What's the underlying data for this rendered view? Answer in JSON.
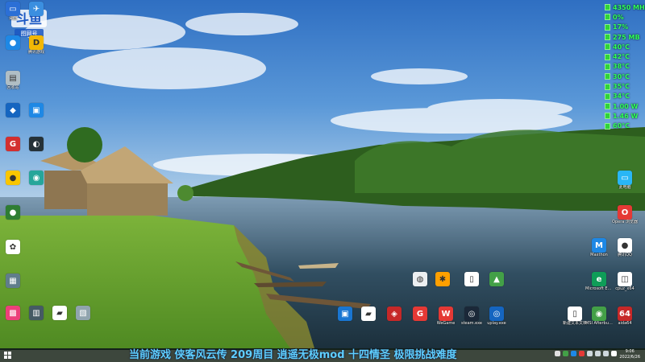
{
  "overlay": {
    "logo_top": "斗鱼",
    "logo_sub": "图网号"
  },
  "monitor": {
    "rows": [
      "4350 MHz",
      "0%",
      "17%",
      "275 MB",
      "40°C",
      "42°C",
      "38°C",
      "30°C",
      "35°C",
      "34°C",
      "1.00 W",
      "1.46 W",
      "60°C"
    ]
  },
  "desktop": {
    "icons": [
      {
        "label": "桌面",
        "color": "#2b6fd6",
        "glyph": "▭"
      },
      {
        "label": "",
        "color": "#3b8fe0",
        "glyph": "✈"
      },
      {
        "label": "",
        "color": "#1e88e5",
        "glyph": "●"
      },
      {
        "label": "腾讯游戏",
        "color": "#f2b705",
        "glyph": "D"
      },
      {
        "label": "回收站",
        "color": "#b0bec5",
        "glyph": "▤"
      },
      {
        "label": "",
        "color": "#1565c0",
        "glyph": "◆"
      },
      {
        "label": "",
        "color": "#1e88e5",
        "glyph": "▣"
      },
      {
        "label": "",
        "color": "#d32f2f",
        "glyph": "G"
      },
      {
        "label": "",
        "color": "#263238",
        "glyph": "◐"
      },
      {
        "label": "",
        "color": "#f9c600",
        "glyph": "●"
      },
      {
        "label": "",
        "color": "#26a69a",
        "glyph": "◉"
      },
      {
        "label": "",
        "color": "#2e7d32",
        "glyph": "●"
      },
      {
        "label": "",
        "color": "#ffffff",
        "glyph": "✿"
      },
      {
        "label": "",
        "color": "#607d8b",
        "glyph": "▦"
      },
      {
        "label": "",
        "color": "#ec407a",
        "glyph": "▩"
      },
      {
        "label": "",
        "color": "#455a64",
        "glyph": "▥"
      },
      {
        "label": "",
        "color": "#ffffff",
        "glyph": "▰"
      },
      {
        "label": "",
        "color": "#90a4ae",
        "glyph": "▧"
      },
      {
        "label": "",
        "color": "#eceff1",
        "glyph": "◍"
      },
      {
        "label": "",
        "color": "#ffa000",
        "glyph": "✱"
      },
      {
        "label": "",
        "color": "#ffffff",
        "glyph": "▯"
      },
      {
        "label": "",
        "color": "#43a047",
        "glyph": "▲"
      },
      {
        "label": "",
        "color": "#1976d2",
        "glyph": "▣"
      },
      {
        "label": "",
        "color": "#ffffff",
        "glyph": "▰"
      },
      {
        "label": "",
        "color": "#c62828",
        "glyph": "◈"
      },
      {
        "label": "",
        "color": "#e53935",
        "glyph": "G"
      },
      {
        "label": "WeGame",
        "color": "#e53935",
        "glyph": "W"
      },
      {
        "label": "steam.exe",
        "color": "#1b2838",
        "glyph": "◎"
      },
      {
        "label": "uplay.exe",
        "color": "#1565c0",
        "glyph": "◎"
      },
      {
        "label": "此电脑",
        "color": "#29b6f6",
        "glyph": "▭"
      },
      {
        "label": "Opera 浏览器",
        "color": "#e53935",
        "glyph": "O"
      },
      {
        "label": "Maxthon",
        "color": "#1e88e5",
        "glyph": "M"
      },
      {
        "label": "腾讯QQ",
        "color": "#ffffff",
        "glyph": "●"
      },
      {
        "label": "Microsoft Edge",
        "color": "#0f9d58",
        "glyph": "e"
      },
      {
        "label": "cpuz_x64",
        "color": "#ffffff",
        "glyph": "◫"
      },
      {
        "label": "新建文本文档",
        "color": "#ffffff",
        "glyph": "▯"
      },
      {
        "label": "MSI Afterburner",
        "color": "#43a047",
        "glyph": "◉"
      },
      {
        "label": "aida64",
        "color": "#c62828",
        "glyph": "64"
      }
    ]
  },
  "taskbar": {
    "ticker": "当前游戏  侠客风云传  209周目  逍遥无极mod  十四情圣  极限挑战难度",
    "time": "9:06",
    "date": "2022/6/26"
  },
  "colors": {
    "monitor_green": "#2fff5a",
    "ticker_blue": "#5fd0ff"
  }
}
